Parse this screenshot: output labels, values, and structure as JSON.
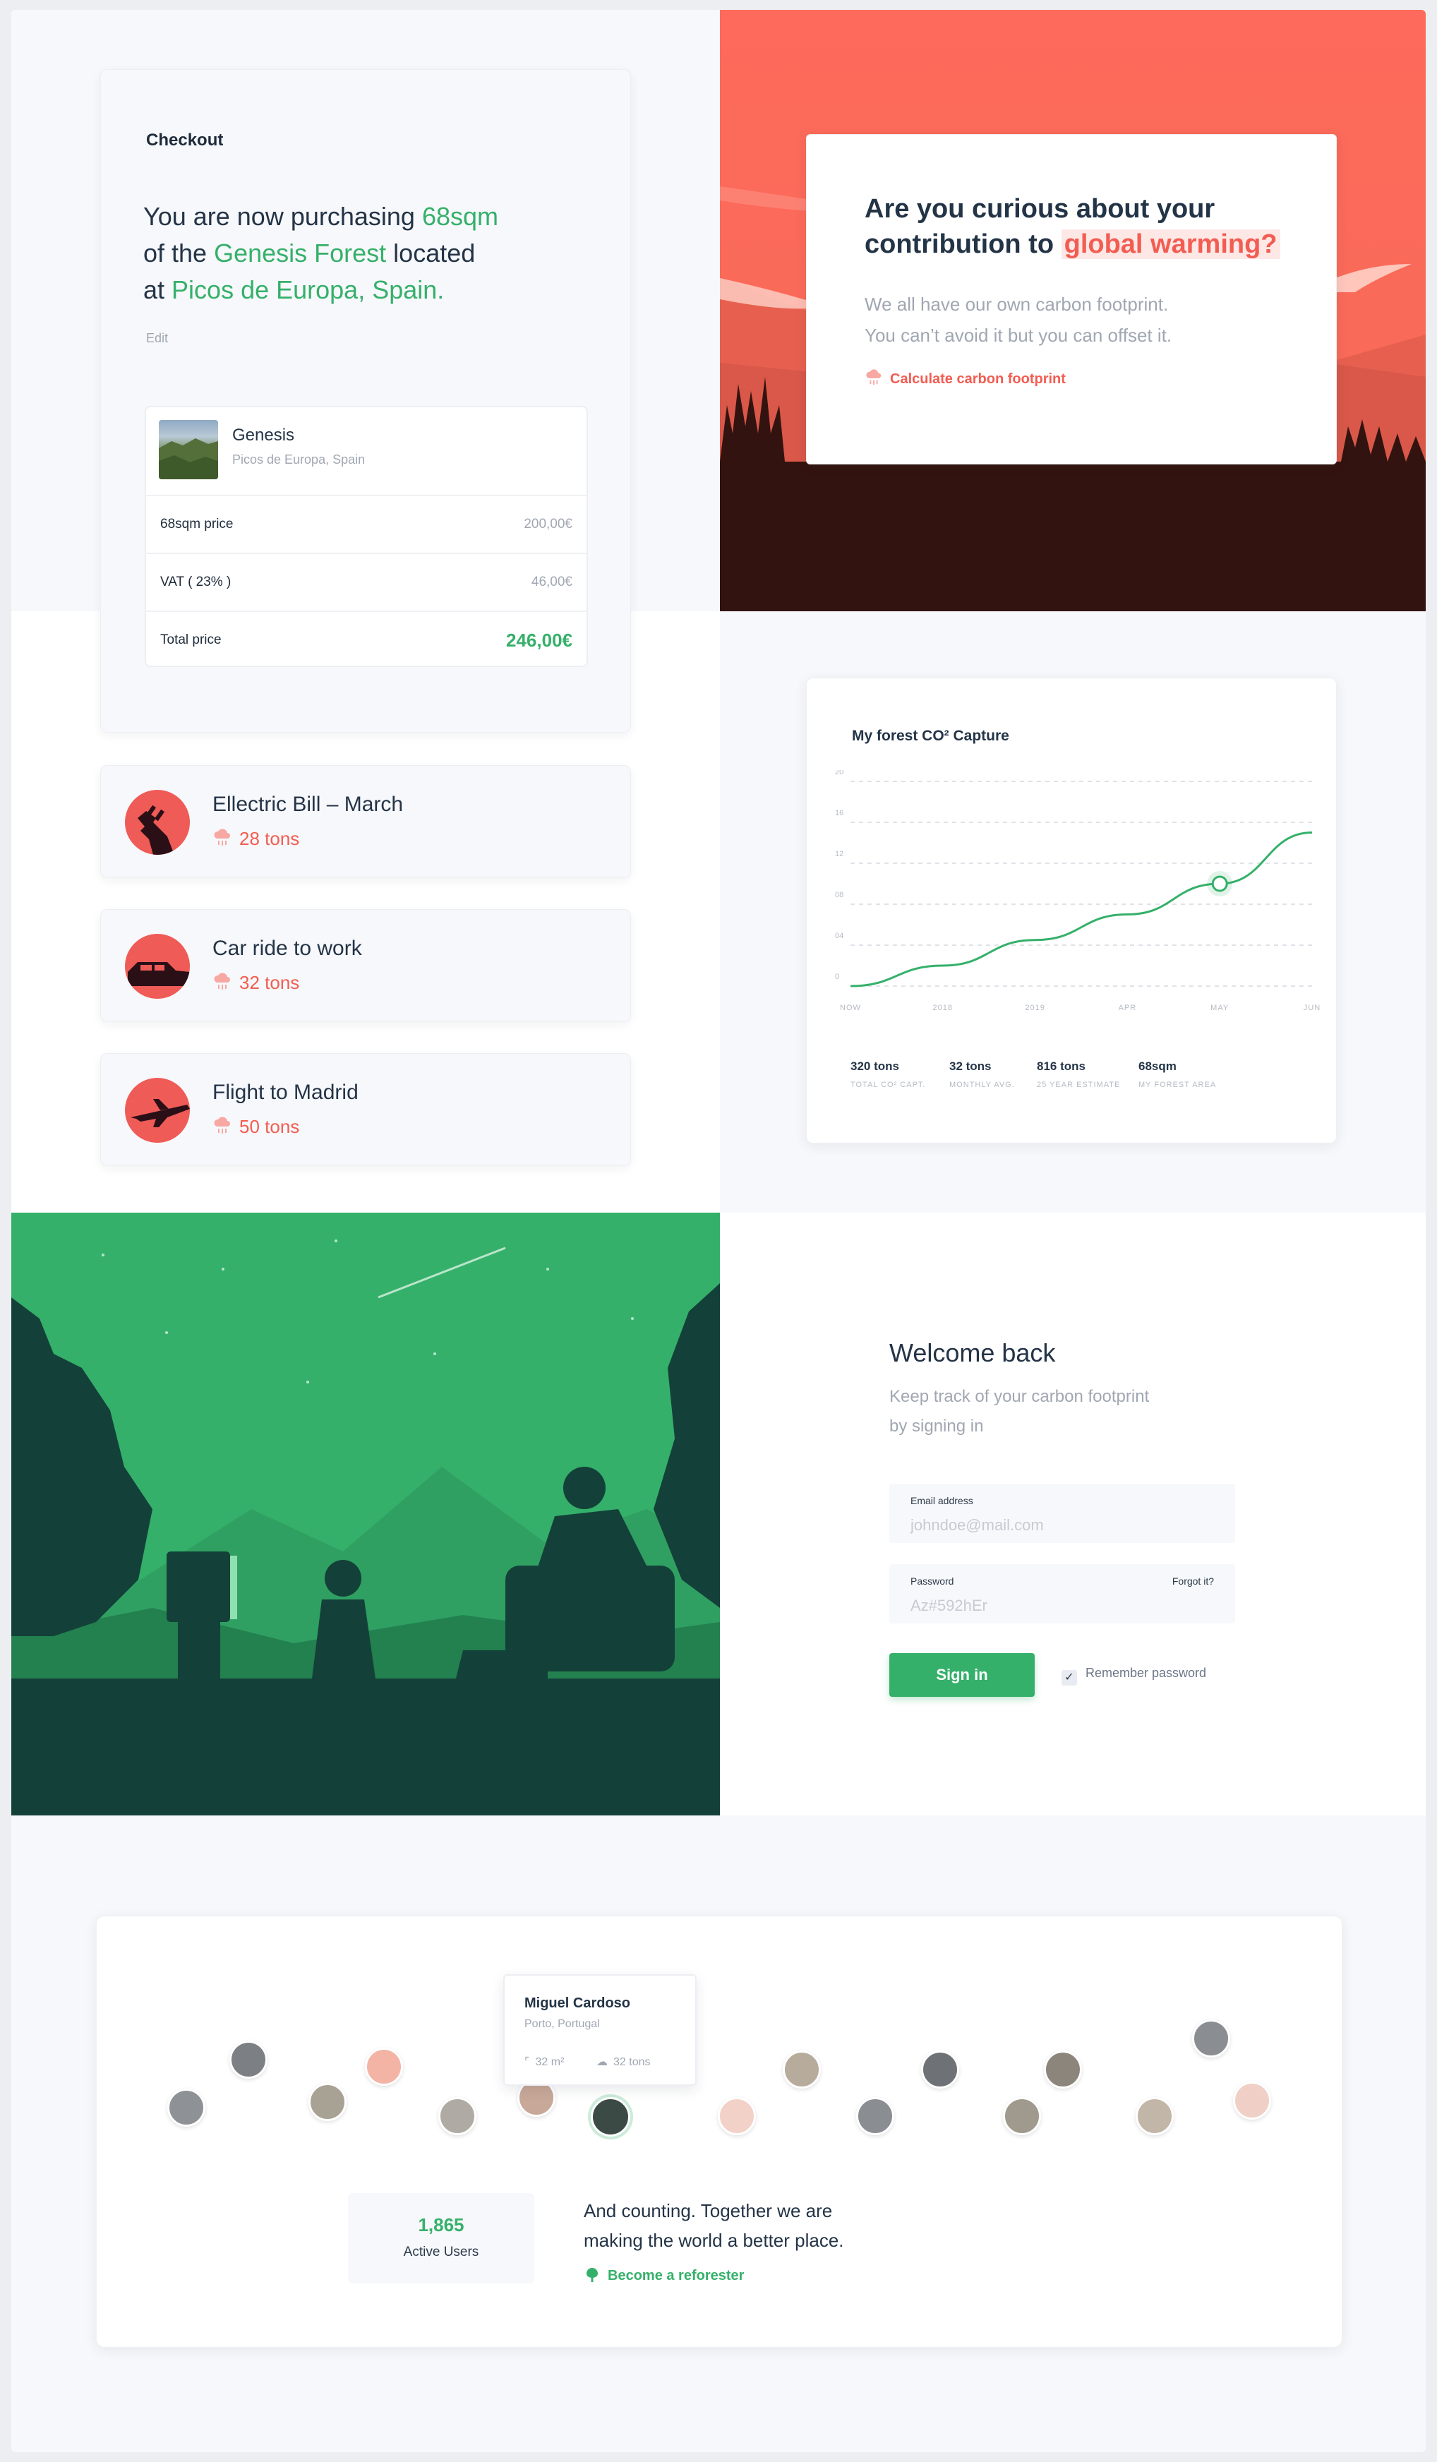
{
  "checkout": {
    "label": "Checkout",
    "line1_pre": "You are now purchasing ",
    "line1_hl": "68sqm",
    "line2_pre": "of the ",
    "line2_hl": "Genesis Forest",
    "line2_post": " located",
    "line3_pre": "at ",
    "line3_hl": "Picos de Europa, Spain.",
    "edit": "Edit",
    "product": {
      "name": "Genesis",
      "location": "Picos de Europa, Spain"
    },
    "rows": [
      {
        "label": "68sqm price",
        "value": "200,00€"
      },
      {
        "label": "VAT ( 23% )",
        "value": "46,00€"
      }
    ],
    "total": {
      "label": "Total price",
      "value": "246,00€"
    }
  },
  "hero": {
    "q_line1": "Are you curious about your",
    "q_line2_pre": "contribution to ",
    "q_line2_hl": "global warming?",
    "sub1": "We all have our own carbon footprint.",
    "sub2": "You can’t avoid it but you can offset it.",
    "cta": "Calculate carbon footprint",
    "colors": {
      "sky": "#fd6b5c",
      "ground": "#33130f",
      "accent": "#f25d52"
    }
  },
  "bills": [
    {
      "title": "Ellectric Bill – March",
      "amount": "28 tons",
      "icon": "plug-icon"
    },
    {
      "title": "Car ride to work",
      "amount": "32 tons",
      "icon": "car-icon"
    },
    {
      "title": "Flight to Madrid",
      "amount": "50 tons",
      "icon": "plane-icon"
    }
  ],
  "chart_card": {
    "title": "My forest CO² Capture",
    "legend": [
      {
        "value": "320 tons",
        "label": "TOTAL CO² CAPT."
      },
      {
        "value": "32 tons",
        "label": "MONTHLY AVG."
      },
      {
        "value": "816 tons",
        "label": "25 YEAR ESTIMATE"
      },
      {
        "value": "68sqm",
        "label": "MY FOREST AREA"
      }
    ]
  },
  "chart_data": {
    "type": "line",
    "title": "My forest CO² Capture",
    "x": [
      "NOW",
      "2018",
      "2019",
      "APR",
      "MAY",
      "JUN"
    ],
    "yticks": [
      "0",
      "04",
      "08",
      "12",
      "16",
      "20"
    ],
    "ylim": [
      0,
      20
    ],
    "series": [
      {
        "values": [
          0,
          2,
          4.5,
          7,
          10,
          15
        ]
      }
    ],
    "highlight_index": 4,
    "grid": true,
    "color": "#35b06a"
  },
  "login": {
    "title": "Welcome back",
    "sub1": "Keep track of your carbon footprint",
    "sub2": "by signing in",
    "email_label": "Email address",
    "email_placeholder": "johndoe@mail.com",
    "password_label": "Password",
    "forgot": "Forgot it?",
    "password_placeholder": "Az#592hEr",
    "signin": "Sign in",
    "remember": "Remember password"
  },
  "illustration": {
    "sky": "#35b06a",
    "ground": "#134139"
  },
  "community": {
    "tooltip": {
      "name": "Miguel Cardoso",
      "location": "Porto, Portugal",
      "area": "32 m²",
      "tons": "32 tons"
    },
    "stat_value": "1,865",
    "stat_label": "Active Users",
    "text1": "And counting. Together we are",
    "text2": "making the world a better place.",
    "cta": "Become a reforester"
  }
}
